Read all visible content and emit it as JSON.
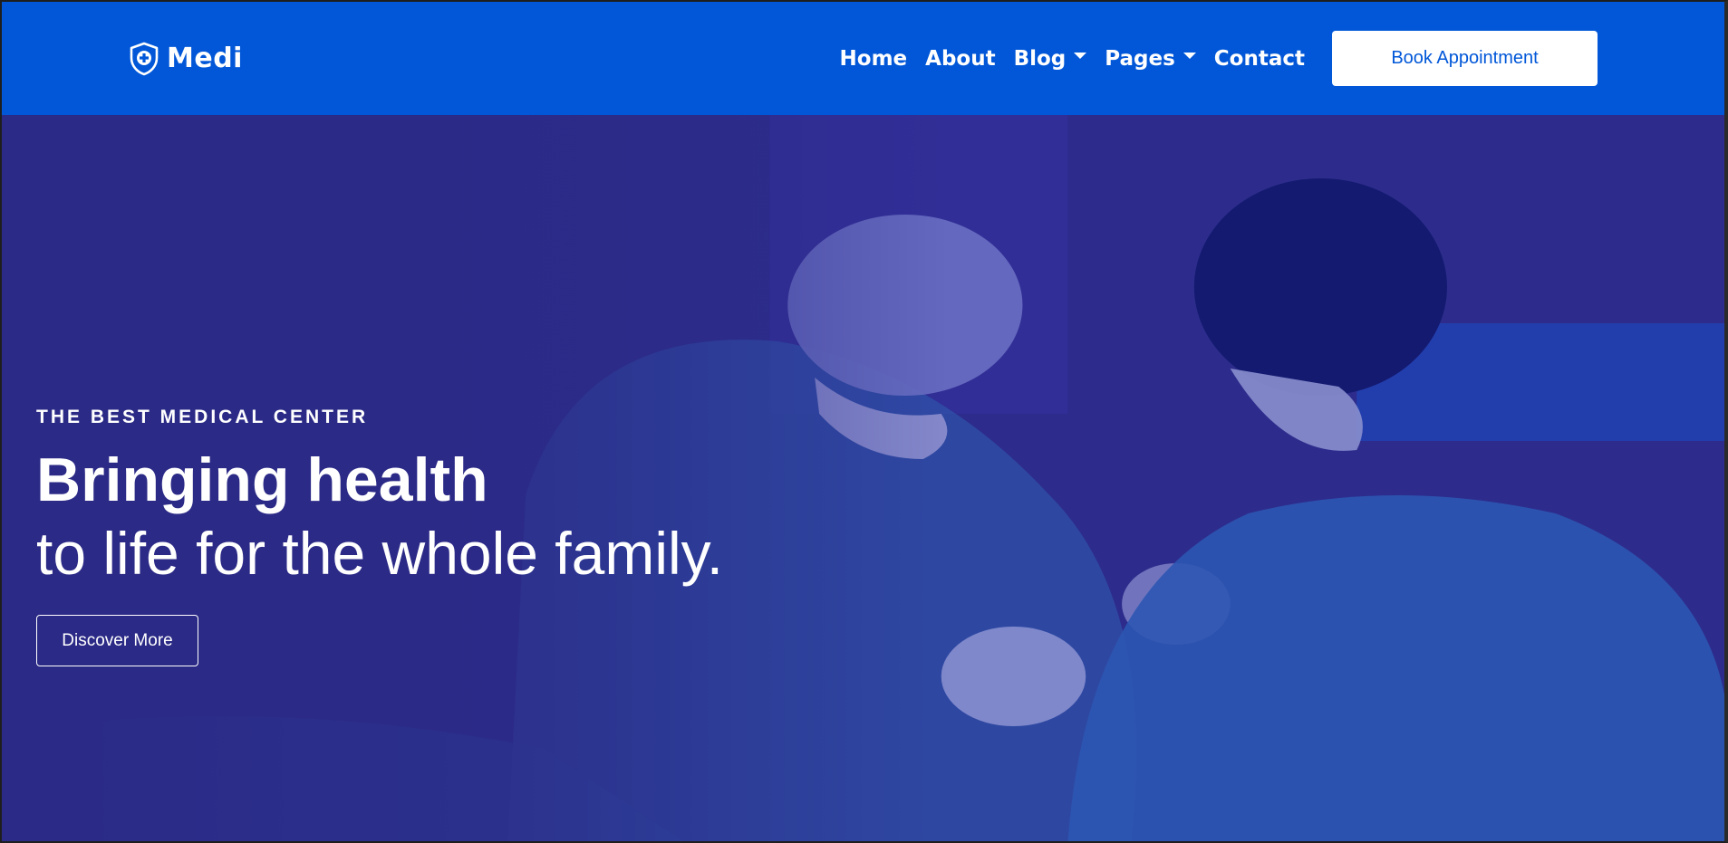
{
  "navbar": {
    "brand_name": "Medi",
    "brand_icon": "shield-plus-icon",
    "links": [
      {
        "label": "Home",
        "dropdown": false
      },
      {
        "label": "About",
        "dropdown": false
      },
      {
        "label": "Blog",
        "dropdown": true
      },
      {
        "label": "Pages",
        "dropdown": true
      },
      {
        "label": "Contact",
        "dropdown": false
      }
    ],
    "cta_label": "Book Appointment",
    "background_color": "#0157d8"
  },
  "hero": {
    "eyebrow": "THE BEST MEDICAL CENTER",
    "headline_bold": "Bringing health",
    "headline_light": "to life for the whole family.",
    "button_label": "Discover More",
    "overlay_color": "#2a2a8a"
  }
}
